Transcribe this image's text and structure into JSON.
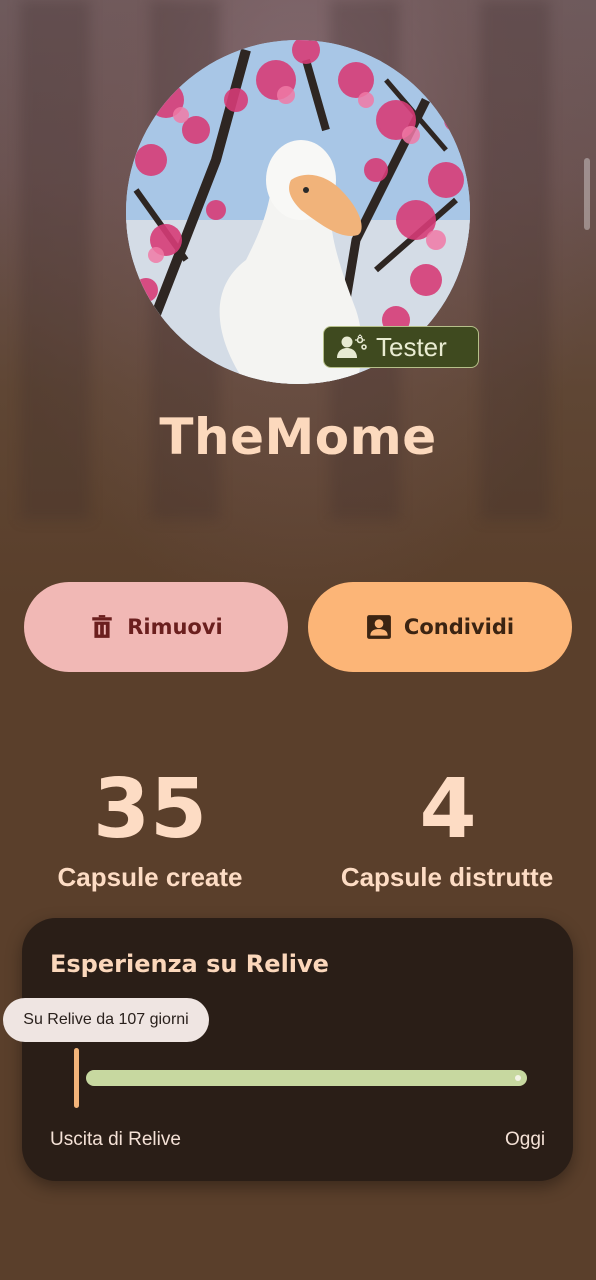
{
  "profile": {
    "username": "TheMome",
    "badge_label": "Tester",
    "badge_icon": "person-sparkle-icon"
  },
  "actions": {
    "remove_label": "Rimuovi",
    "remove_icon": "trash-icon",
    "share_label": "Condividi",
    "share_icon": "contact-card-icon"
  },
  "stats": [
    {
      "value": "35",
      "label": "Capsule create"
    },
    {
      "value": "4",
      "label": "Capsule distrutte"
    }
  ],
  "experience": {
    "title": "Esperienza su Relive",
    "tooltip": "Su Relive da 107 giorni",
    "axis_start": "Uscita di Relive",
    "axis_end": "Oggi"
  },
  "colors": {
    "background": "#5a3f2b",
    "accent_peach": "#fcb577",
    "accent_pink": "#f1b8b5",
    "track": "#c7d8a0",
    "text_peach": "#fddcc4"
  }
}
